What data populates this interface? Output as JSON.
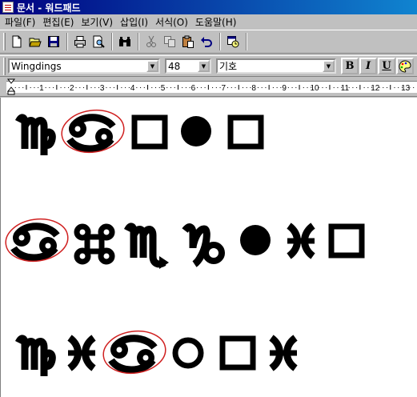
{
  "window": {
    "title": "문서 - 워드패드"
  },
  "menu": [
    "파일(F)",
    "편집(E)",
    "보기(V)",
    "삽입(I)",
    "서식(O)",
    "도움말(H)"
  ],
  "toolbar": {
    "buttons": [
      "new-icon",
      "open-icon",
      "save-icon",
      "print-icon",
      "print-preview-icon",
      "find-icon",
      "cut-icon",
      "copy-icon",
      "paste-icon",
      "undo-icon",
      "date-time-icon"
    ]
  },
  "format": {
    "font": "Wingdings",
    "size": "48",
    "script": "기호",
    "bold": "B",
    "italic": "I",
    "underline": "U",
    "color_icon": "color-palette-icon"
  },
  "ruler": {
    "labels": [
      "1",
      "2",
      "3",
      "4",
      "5",
      "6",
      "7",
      "8",
      "9",
      "10",
      "11",
      "12",
      "13"
    ]
  },
  "document": {
    "lines": [
      {
        "glyphs": [
          "virgo",
          "cancer",
          "square",
          "circle",
          "square"
        ],
        "circled": 1
      },
      {
        "glyphs": [
          "cancer",
          "command",
          "scorpio",
          "capricorn",
          "circle",
          "pisces",
          "square"
        ],
        "circled": 0
      },
      {
        "glyphs": [
          "virgo",
          "pisces",
          "cancer",
          "ring",
          "square",
          "pisces"
        ],
        "circled": 2
      }
    ],
    "annotation_color": "#d02020"
  },
  "colors": {
    "title_start": "#000080",
    "title_end": "#1084d0",
    "chrome": "#c0c0c0"
  }
}
